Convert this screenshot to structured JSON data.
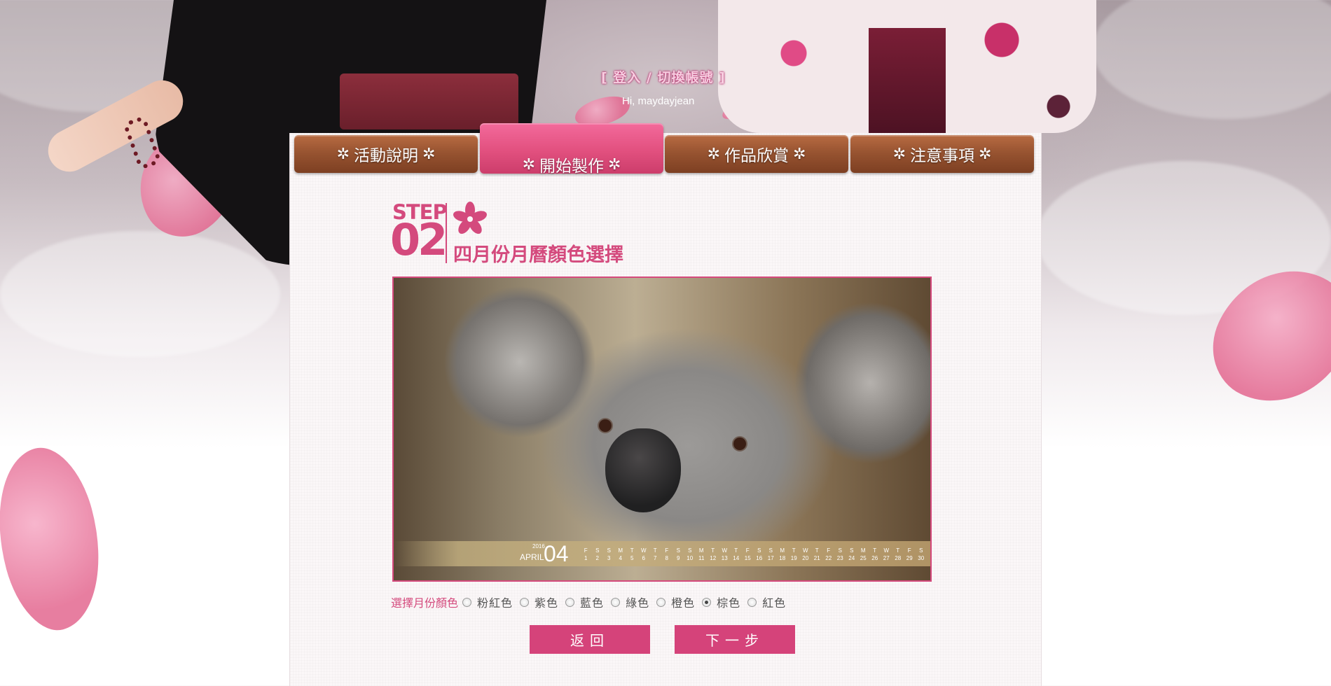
{
  "header": {
    "login_link": "[ 登入 / 切換帳號 ]",
    "greeting": "Hi, maydayjean"
  },
  "tabs": [
    {
      "label": "活動說明",
      "active": false
    },
    {
      "label": "開始製作",
      "active": true
    },
    {
      "label": "作品欣賞",
      "active": false
    },
    {
      "label": "注意事項",
      "active": false
    }
  ],
  "step": {
    "word": "STEP",
    "number": "02",
    "title": "四月份月曆顏色選擇"
  },
  "calendar": {
    "year": "2016",
    "month_name": "APRIL",
    "month_number": "04",
    "weekdays": [
      "F",
      "S",
      "S",
      "M",
      "T",
      "W",
      "T",
      "F",
      "S",
      "S",
      "M",
      "T",
      "W",
      "T",
      "F",
      "S",
      "S",
      "M",
      "T",
      "W",
      "T",
      "F",
      "S",
      "S",
      "M",
      "T",
      "W",
      "T",
      "F",
      "S"
    ],
    "dates": [
      "1",
      "2",
      "3",
      "4",
      "5",
      "6",
      "7",
      "8",
      "9",
      "10",
      "11",
      "12",
      "13",
      "14",
      "15",
      "16",
      "17",
      "18",
      "19",
      "20",
      "21",
      "22",
      "23",
      "24",
      "25",
      "26",
      "27",
      "28",
      "29",
      "30"
    ]
  },
  "color_picker": {
    "label": "選擇月份顏色",
    "options": [
      {
        "label": "粉紅色",
        "checked": false
      },
      {
        "label": "紫色",
        "checked": false
      },
      {
        "label": "藍色",
        "checked": false
      },
      {
        "label": "綠色",
        "checked": false
      },
      {
        "label": "橙色",
        "checked": false
      },
      {
        "label": "棕色",
        "checked": true
      },
      {
        "label": "紅色",
        "checked": false
      }
    ]
  },
  "buttons": {
    "back": "返回",
    "next": "下一步"
  },
  "colors": {
    "accent": "#d5437a",
    "tab_brown": "#985431",
    "tab_active": "#e2507f"
  }
}
